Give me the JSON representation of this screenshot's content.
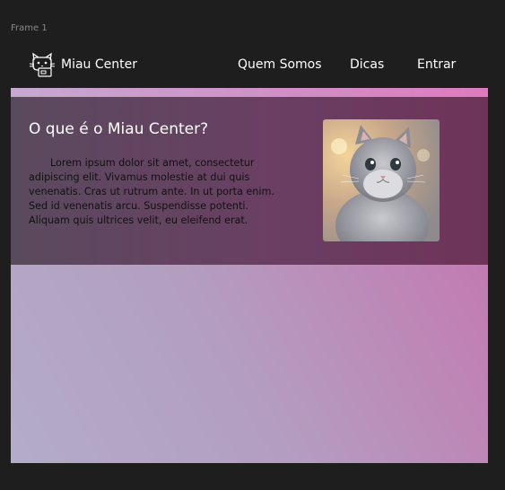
{
  "frame": {
    "label": "Frame 1"
  },
  "nav": {
    "brand": "Miau Center",
    "links": [
      "Quem Somos",
      "Dicas",
      "Entrar"
    ]
  },
  "hero": {
    "title": "O que é o Miau Center?",
    "text": "Lorem ipsum dolor sit amet, consectetur adipiscing elit. Vivamus molestie at dui quis venenatis. Cras ut rutrum ante. In ut porta enim. Sed id venenatis arcu. Suspendisse potenti. Aliquam quis ultrices velit, eu eleifend erat.",
    "image_icon": "cat-photo"
  },
  "colors": {
    "background": "#1e1e1e",
    "hero_bg": "#6a3f63",
    "accent_pink": "#c469a6"
  }
}
